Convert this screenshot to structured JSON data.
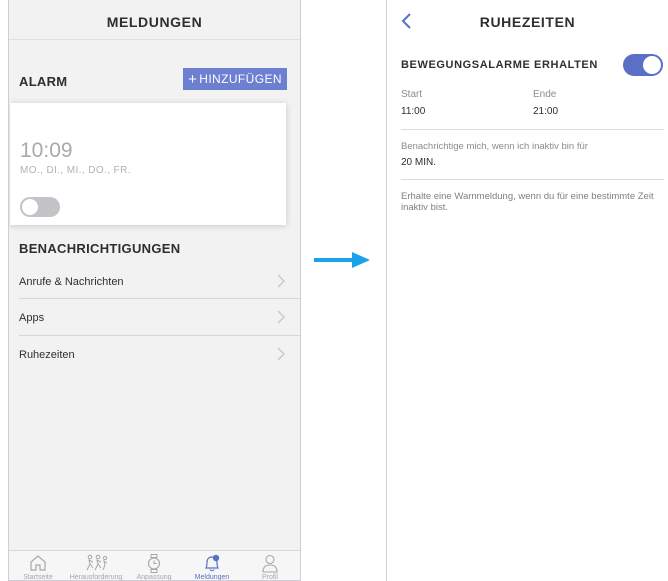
{
  "left_screen": {
    "title": "MELDUNGEN",
    "alarm_section": "ALARM",
    "add_button": {
      "plus": "+",
      "label": "HINZUFÜGEN"
    },
    "alarm_card": {
      "time": "10:09",
      "days": "MO., DI., MI., DO., FR.",
      "enabled": false
    },
    "notifications_section": "BENACHRICHTIGUNGEN",
    "rows": [
      {
        "label": "Anrufe & Nachrichten"
      },
      {
        "label": "Apps"
      },
      {
        "label": "Ruhezeiten"
      }
    ],
    "tabbar": [
      {
        "label": "Startseite",
        "icon": "house-icon",
        "active": false
      },
      {
        "label": "Herausforderung",
        "icon": "runners-icon",
        "active": false
      },
      {
        "label": "Anpassung",
        "icon": "watch-icon",
        "active": false
      },
      {
        "label": "Meldungen",
        "icon": "bell-icon",
        "active": true
      },
      {
        "label": "Profil",
        "icon": "person-icon",
        "active": false
      }
    ]
  },
  "right_screen": {
    "title": "RUHEZEITEN",
    "back_icon": "chevron-left-icon",
    "movement_alarms_label": "BEWEGUNGSALARME ERHALTEN",
    "movement_alarms_enabled": true,
    "start": {
      "label": "Start",
      "value": "11:00"
    },
    "end": {
      "label": "Ende",
      "value": "21:00"
    },
    "inactive_notify_label": "Benachrichtige mich, wenn ich inaktiv bin für",
    "inactive_notify_value": "20 MIN.",
    "description": "Erhalte eine Warnmeldung, wenn du für eine bestimmte Zeit inaktiv bist."
  },
  "colors": {
    "accent": "#5b6fc7",
    "button": "#6d7fd0",
    "arrow": "#1aa3e8",
    "toggle_off": "#c4c4c8"
  }
}
